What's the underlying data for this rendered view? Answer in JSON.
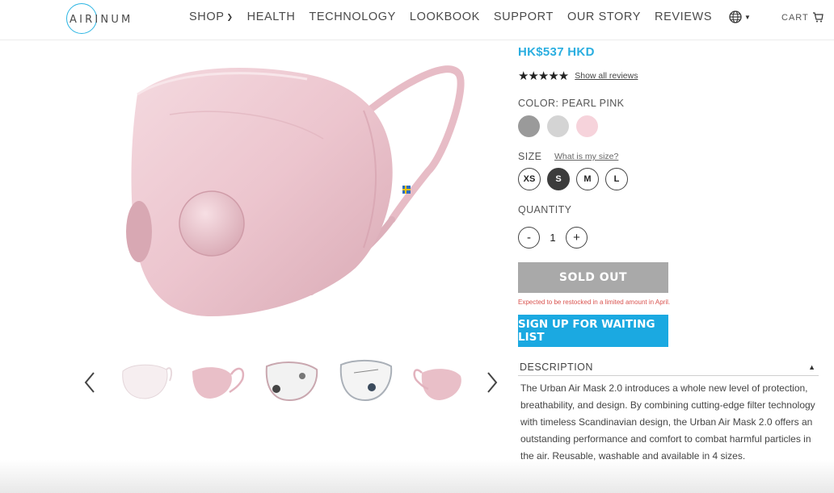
{
  "brand": {
    "logo_text": "AIRINUM"
  },
  "nav": {
    "items": [
      {
        "label": "SHOP",
        "has_dropdown": true
      },
      {
        "label": "HEALTH"
      },
      {
        "label": "TECHNOLOGY"
      },
      {
        "label": "LOOKBOOK"
      },
      {
        "label": "SUPPORT"
      },
      {
        "label": "OUR STORY"
      },
      {
        "label": "REVIEWS"
      }
    ],
    "globe_icon": "globe-icon",
    "cart_label": "CART",
    "cart_icon": "cart-icon"
  },
  "gallery": {
    "main_image": "pink-mask-main",
    "thumbnails": [
      "mask-front-white",
      "mask-side-pink",
      "mask-inside-valves",
      "mask-inside-filters",
      "mask-side-pink-2"
    ],
    "prev_icon": "chevron-left-icon",
    "next_icon": "chevron-right-icon"
  },
  "product": {
    "price": "HK$537 HKD",
    "rating": {
      "stars": 5,
      "link": "Show all reviews"
    },
    "color_label": "COLOR: PEARL PINK",
    "colors": [
      {
        "name": "grey",
        "hex": "#9a9a9a"
      },
      {
        "name": "light-grey",
        "hex": "#d4d4d4"
      },
      {
        "name": "pearl-pink",
        "hex": "#f6d3db"
      }
    ],
    "size_label": "SIZE",
    "size_help": "What is my size?",
    "sizes": [
      {
        "label": "XS",
        "selected": false
      },
      {
        "label": "S",
        "selected": true
      },
      {
        "label": "M",
        "selected": false
      },
      {
        "label": "L",
        "selected": false
      }
    ],
    "quantity_label": "QUANTITY",
    "quantity_value": "1",
    "minus": "-",
    "plus": "+",
    "sold_out_label": "SOLD OUT",
    "restock_note": "Expected to be restocked in a limited amount in April.",
    "waitlist_label": "SIGN UP FOR WAITING LIST",
    "description_title": "DESCRIPTION",
    "description_text": "The Urban Air Mask 2.0 introduces a whole new level of protection, breathability, and design. By combining cutting-edge filter technology with timeless Scandinavian design, the Urban Air Mask 2.0 offers an outstanding performance and comfort to combat harmful particles in the air. Reusable, washable and available in 4 sizes."
  },
  "colors": {
    "accent": "#2aaee0",
    "button_blue": "#1ba9e1",
    "sold_out_grey": "#a9a9a9",
    "restock_red": "#d9534f"
  }
}
